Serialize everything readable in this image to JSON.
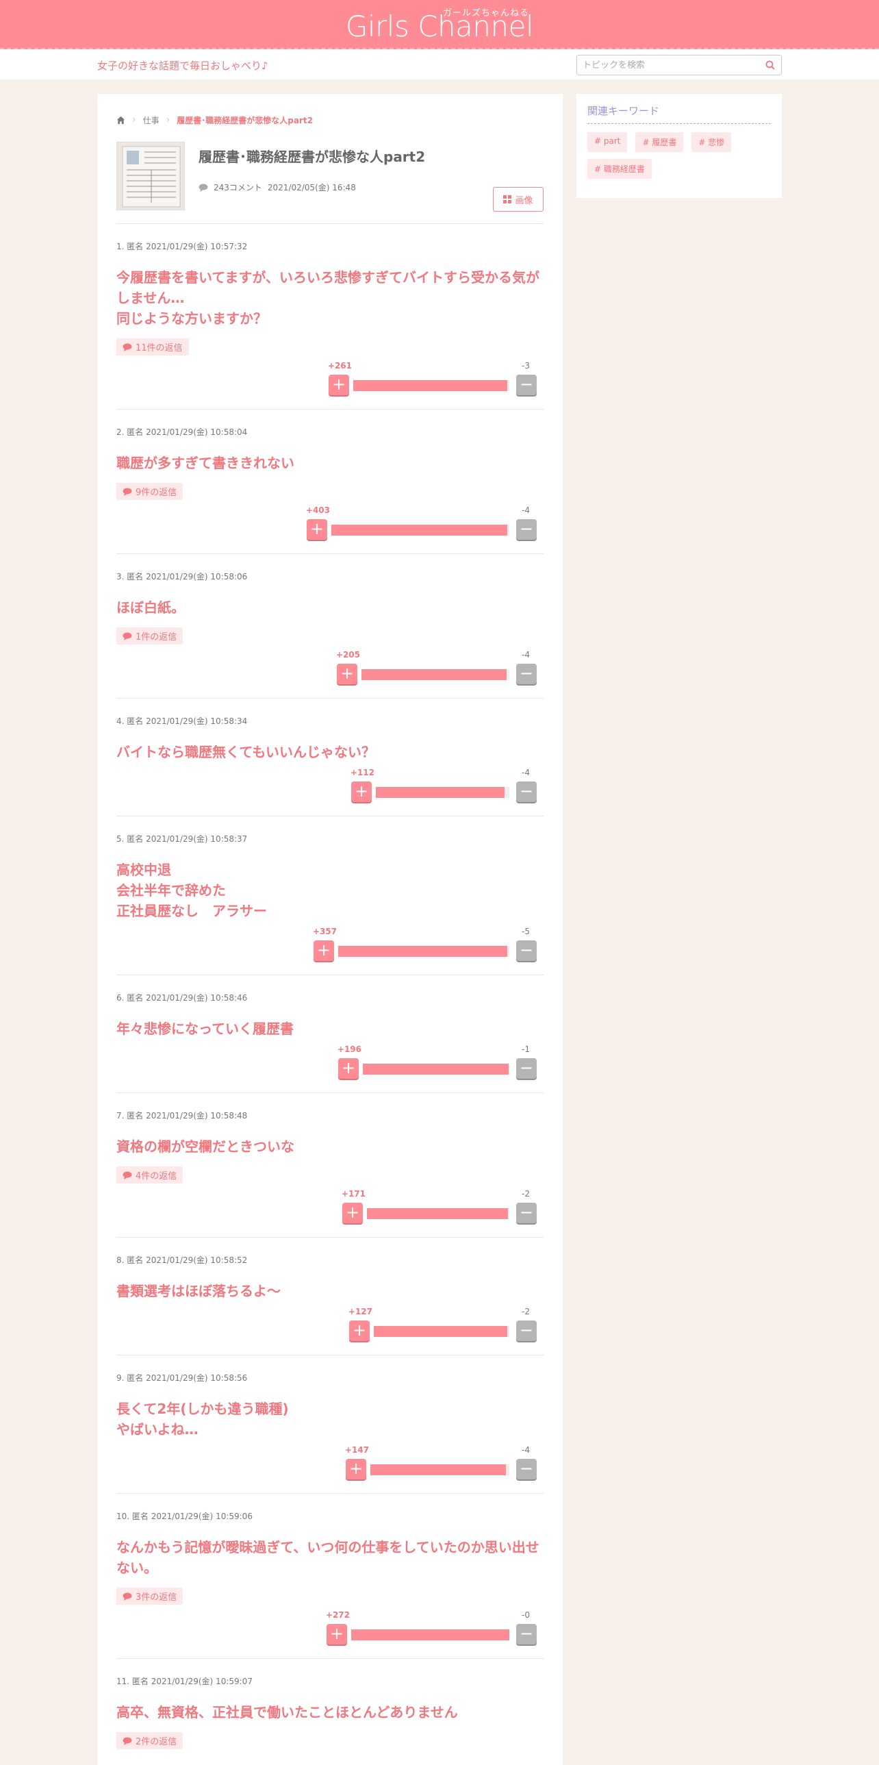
{
  "header": {
    "logo_kana": "ガールズちゃんねる",
    "logo_text": "Girls Channel"
  },
  "subbar": {
    "tagline": "女子の好きな話題で毎日おしゃべり♪",
    "search_placeholder": "トピックを検索"
  },
  "breadcrumb": {
    "category": "仕事",
    "current": "履歴書･職務経歴書が悲惨な人part2"
  },
  "topic": {
    "title": "履歴書･職務経歴書が悲惨な人part2",
    "comment_count": "243コメント",
    "date": "2021/02/05(金) 16:48",
    "image_button": "画像"
  },
  "sidebar": {
    "title": "関連キーワード",
    "keywords": [
      "# part",
      "# 履歴書",
      "# 悲惨",
      "# 職務経歴書"
    ]
  },
  "comments": [
    {
      "head": "1. 匿名 2021/01/29(金) 10:57:32",
      "body": "今履歴書を書いてますが、いろいろ悲惨すぎてバイトすら受かる気がしません…\n同じような方いますか？",
      "reply": "11件の返信",
      "plus": "+261",
      "minus": "-3",
      "ratio": 0.989
    },
    {
      "head": "2. 匿名 2021/01/29(金) 10:58:04",
      "body": "職歴が多すぎて書ききれない",
      "reply": "9件の返信",
      "plus": "+403",
      "minus": "-4",
      "ratio": 0.99
    },
    {
      "head": "3. 匿名 2021/01/29(金) 10:58:06",
      "body": "ほぼ白紙。",
      "reply": "1件の返信",
      "plus": "+205",
      "minus": "-4",
      "ratio": 0.981
    },
    {
      "head": "4. 匿名 2021/01/29(金) 10:58:34",
      "body": "バイトなら職歴無くてもいいんじゃない？",
      "reply": "",
      "plus": "+112",
      "minus": "-4",
      "ratio": 0.966
    },
    {
      "head": "5. 匿名 2021/01/29(金) 10:58:37",
      "body": "高校中退\n会社半年で辞めた\n正社員歴なし　アラサー",
      "reply": "",
      "plus": "+357",
      "minus": "-5",
      "ratio": 0.986
    },
    {
      "head": "6. 匿名 2021/01/29(金) 10:58:46",
      "body": "年々悲惨になっていく履歴書",
      "reply": "",
      "plus": "+196",
      "minus": "-1",
      "ratio": 0.995
    },
    {
      "head": "7. 匿名 2021/01/29(金) 10:58:48",
      "body": "資格の欄が空欄だときついな",
      "reply": "4件の返信",
      "plus": "+171",
      "minus": "-2",
      "ratio": 0.988
    },
    {
      "head": "8. 匿名 2021/01/29(金) 10:58:52",
      "body": "書類選考はほぼ落ちるよ〜",
      "reply": "",
      "plus": "+127",
      "minus": "-2",
      "ratio": 0.984
    },
    {
      "head": "9. 匿名 2021/01/29(金) 10:58:56",
      "body": "長くて2年(しかも違う職種)\nやばいよね…",
      "reply": "",
      "plus": "+147",
      "minus": "-4",
      "ratio": 0.974
    },
    {
      "head": "10. 匿名 2021/01/29(金) 10:59:06",
      "body": "なんかもう記憶が曖昧過ぎて、いつ何の仕事をしていたのか思い出せない。",
      "reply": "3件の返信",
      "plus": "+272",
      "minus": "-0",
      "ratio": 1.0
    },
    {
      "head": "11. 匿名 2021/01/29(金) 10:59:07",
      "body": "高卒、無資格、正社員で働いたことほとんどありません",
      "reply": "2件の返信",
      "plus": "",
      "minus": "",
      "ratio": 0
    }
  ]
}
